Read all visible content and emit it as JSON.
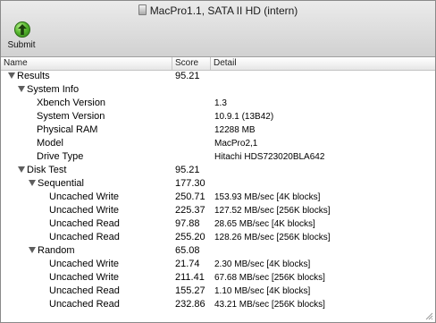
{
  "window": {
    "title": "MacPro1.1, SATA II HD (intern)"
  },
  "toolbar": {
    "submit_label": "Submit"
  },
  "columns": {
    "name": "Name",
    "score": "Score",
    "detail": "Detail"
  },
  "rows": [
    {
      "name": "Results",
      "score": "95.21",
      "detail": ""
    },
    {
      "name": "System Info",
      "score": "",
      "detail": ""
    },
    {
      "name": "Xbench Version",
      "score": "",
      "detail": "1.3"
    },
    {
      "name": "System Version",
      "score": "",
      "detail": "10.9.1 (13B42)"
    },
    {
      "name": "Physical RAM",
      "score": "",
      "detail": "12288 MB"
    },
    {
      "name": "Model",
      "score": "",
      "detail": "MacPro2,1"
    },
    {
      "name": "Drive Type",
      "score": "",
      "detail": "Hitachi HDS723020BLA642"
    },
    {
      "name": "Disk Test",
      "score": "95.21",
      "detail": ""
    },
    {
      "name": "Sequential",
      "score": "177.30",
      "detail": ""
    },
    {
      "name": "Uncached Write",
      "score": "250.71",
      "detail": "153.93 MB/sec [4K blocks]"
    },
    {
      "name": "Uncached Write",
      "score": "225.37",
      "detail": "127.52 MB/sec [256K blocks]"
    },
    {
      "name": "Uncached Read",
      "score": "97.88",
      "detail": "28.65 MB/sec [4K blocks]"
    },
    {
      "name": "Uncached Read",
      "score": "255.20",
      "detail": "128.26 MB/sec [256K blocks]"
    },
    {
      "name": "Random",
      "score": "65.08",
      "detail": ""
    },
    {
      "name": "Uncached Write",
      "score": "21.74",
      "detail": "2.30 MB/sec [4K blocks]"
    },
    {
      "name": "Uncached Write",
      "score": "211.41",
      "detail": "67.68 MB/sec [256K blocks]"
    },
    {
      "name": "Uncached Read",
      "score": "155.27",
      "detail": "1.10 MB/sec [4K blocks]"
    },
    {
      "name": "Uncached Read",
      "score": "232.86",
      "detail": "43.21 MB/sec [256K blocks]"
    }
  ]
}
